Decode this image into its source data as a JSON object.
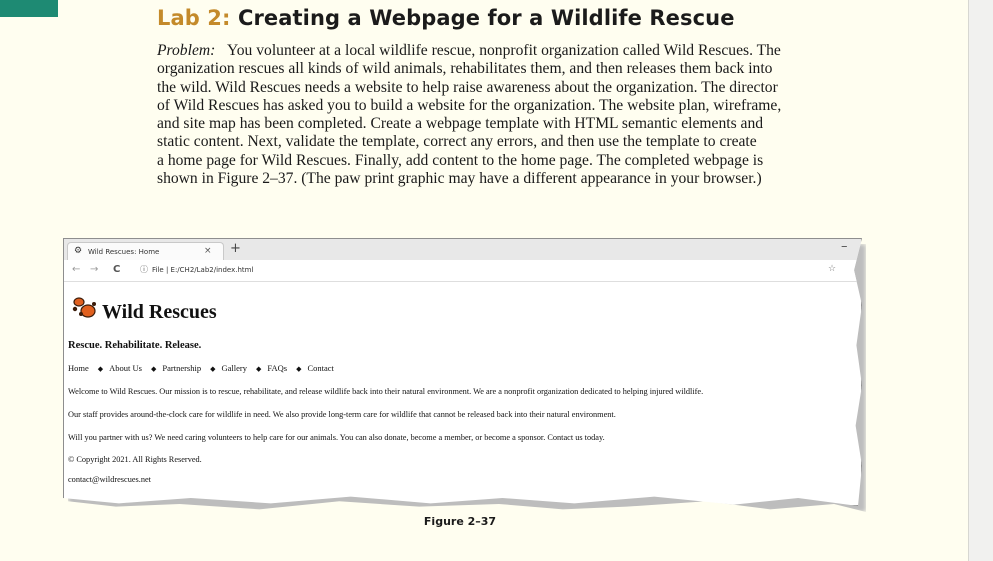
{
  "lab": {
    "prefix": "Lab 2:",
    "title": "Creating a Webpage for a Wildlife Rescue"
  },
  "problem": {
    "lead": "Problem:",
    "lines": [
      "You volunteer at a local wildlife rescue, nonprofit organization called Wild Rescues. The",
      "organization rescues all kinds of wild animals, rehabilitates them, and then releases them back into",
      "the wild. Wild Rescues needs a website to help raise awareness about the organization. The director",
      "of Wild Rescues has asked you to build a website for the organization. The website plan, wireframe,",
      "and site map has been completed. Create a webpage template with HTML semantic elements and",
      "static content. Next, validate the template, correct any errors, and then use the template to create",
      "a home page for Wild Rescues. Finally, add content to the home page. The completed webpage is",
      "shown in Figure 2–37. (The paw print graphic may have a different  appearance in your browser.)"
    ]
  },
  "browser": {
    "tab_title": "Wild Rescues: Home",
    "tab_close": "×",
    "new_tab": "+",
    "minimize": "–",
    "back": "←",
    "forward": "→",
    "reload": "C",
    "info_icon": "ⓘ",
    "url": "File  |  E:/CH2/Lab2/index.html",
    "star": "☆"
  },
  "site": {
    "name": "Wild Rescues",
    "tagline": "Rescue. Rehabilitate. Release.",
    "nav": [
      "Home",
      "About Us",
      "Partnership",
      "Gallery",
      "FAQs",
      "Contact"
    ],
    "nav_separator": "◆",
    "paragraphs": [
      "Welcome to Wild Rescues. Our mission is to rescue, rehabilitate, and release wildlife back into their natural environment. We are a nonprofit organization dedicated to helping injured wildlife.",
      "Our staff provides around-the-clock care for wildlife in need. We also provide long-term care for wildlife that cannot be released back into their natural environment.",
      "Will you partner with us? We need caring volunteers to help care for our animals. You can also donate, become a member, or become a sponsor. Contact us today.",
      "© Copyright 2021. All Rights Reserved.",
      "contact@wildrescues.net"
    ]
  },
  "figure_caption": "Figure 2–37",
  "colors": {
    "accent_green": "#1e8a73",
    "lab_prefix": "#c48a2a",
    "paw": "#e0601f"
  }
}
